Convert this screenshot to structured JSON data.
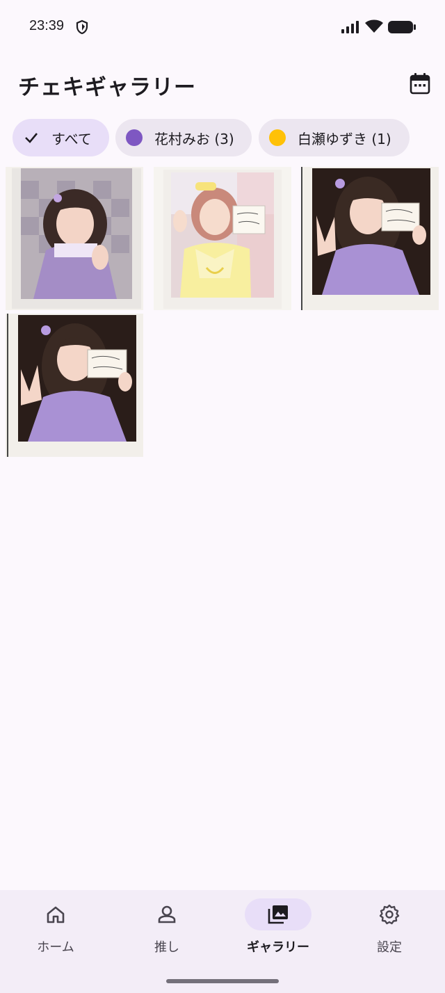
{
  "status_bar": {
    "time": "23:39"
  },
  "header": {
    "title": "チェキギャラリー",
    "calendar_icon": "calendar-icon"
  },
  "filters": [
    {
      "label": "すべて",
      "selected": true,
      "icon": "check-icon"
    },
    {
      "label": "花村みお (3)",
      "selected": false,
      "color": "#7e57c2"
    },
    {
      "label": "白瀬ゆずき (1)",
      "selected": false,
      "color": "#ffc107"
    }
  ],
  "gallery": {
    "photos": [
      {
        "member": "花村みお",
        "theme": "purple"
      },
      {
        "member": "白瀬ゆずき",
        "theme": "yellow"
      },
      {
        "member": "花村みお",
        "theme": "purple"
      },
      {
        "member": "花村みお",
        "theme": "purple"
      }
    ]
  },
  "bottom_nav": {
    "items": [
      {
        "label": "ホーム",
        "icon": "home-icon",
        "active": false
      },
      {
        "label": "推し",
        "icon": "person-icon",
        "active": false
      },
      {
        "label": "ギャラリー",
        "icon": "gallery-icon",
        "active": true
      },
      {
        "label": "設定",
        "icon": "gear-icon",
        "active": false
      }
    ]
  },
  "colors": {
    "background": "#fcf8fd",
    "chip_selected": "#e8def8",
    "chip_default": "#ece6f0",
    "nav_background": "#f3edf7"
  }
}
